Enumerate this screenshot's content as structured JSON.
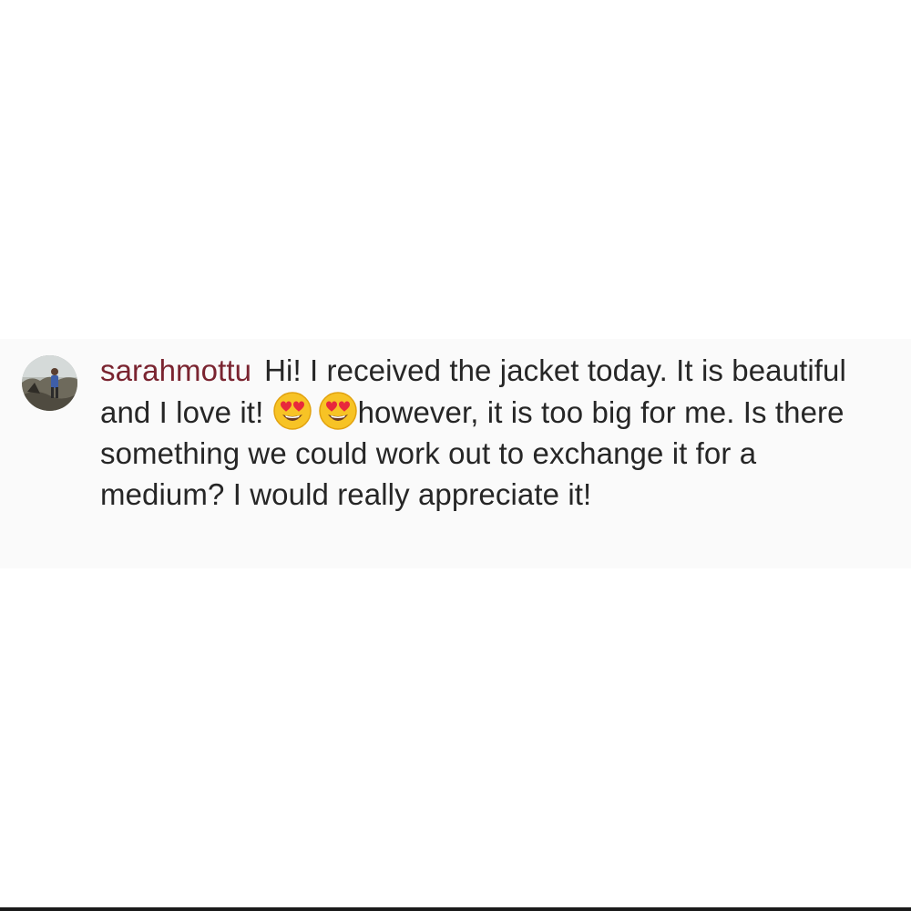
{
  "comment": {
    "username": "sarahmottu",
    "text_part1": "Hi! I received the jacket today. It is beautiful and I love it! ",
    "emojis": [
      "heart-eyes-emoji",
      "heart-eyes-emoji"
    ],
    "text_part2": "however, it is too big for me. Is there something we could work out to exchange it for a medium? I would really appreciate it!"
  },
  "colors": {
    "username": "#7a2430",
    "body_text": "#262626",
    "band_background": "#fafafa",
    "emoji_face": "#f7c325",
    "emoji_heart": "#e8283c"
  }
}
